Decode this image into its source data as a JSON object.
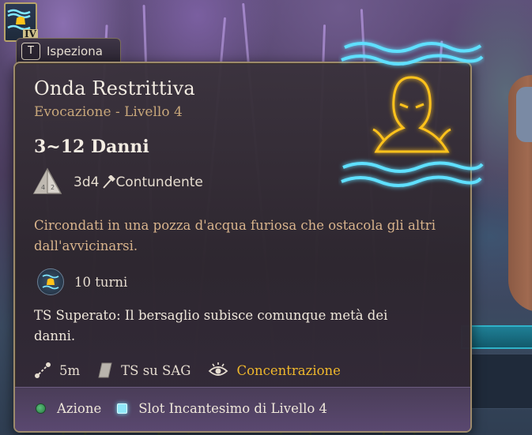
{
  "inspect": {
    "key": "T",
    "label": "Ispeziona"
  },
  "thumbnail": {
    "level_numeral": "IV",
    "icon": "restraining-wave-icon"
  },
  "spell": {
    "name": "Onda Restrittiva",
    "school_level": "Evocazione - Livello 4",
    "damage_range": "3~12 Danni",
    "dice": "3d4",
    "damage_type": "Contundente",
    "description": "Circondati in una pozza d'acqua furiosa che ostacola gli altri dall'avvicinarsi.",
    "duration": "10 turni",
    "save_effect": "TS Superato: Il bersaglio subisce comunque metà dei danni."
  },
  "properties": {
    "range": "5m",
    "saving_throw": "TS su SAG",
    "concentration": "Concentrazione"
  },
  "costs": {
    "action": "Azione",
    "spell_slot": "Slot Incantesimo di Livello 4"
  },
  "colors": {
    "title": "#f3ece2",
    "school": "#c8a77a",
    "description": "#d9b48c",
    "concentration": "#f0b82c",
    "glow_gold": "#ffc21a",
    "glow_water": "#5fe0ff",
    "panel_border": "#9c8a6c"
  }
}
